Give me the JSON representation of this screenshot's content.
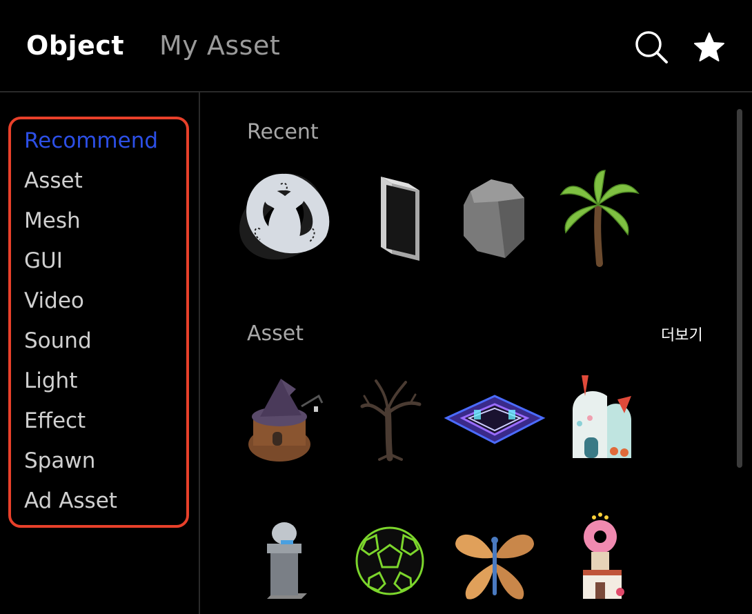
{
  "header": {
    "tabs": [
      {
        "label": "Object",
        "active": true
      },
      {
        "label": "My Asset",
        "active": false
      }
    ],
    "icons": [
      "search-icon",
      "star-icon"
    ]
  },
  "sidebar": {
    "highlight_color": "#e8402a",
    "active_color": "#2c4fe6",
    "items": [
      {
        "label": "Recommend",
        "active": true
      },
      {
        "label": "Asset"
      },
      {
        "label": "Mesh"
      },
      {
        "label": "GUI"
      },
      {
        "label": "Video"
      },
      {
        "label": "Sound"
      },
      {
        "label": "Light"
      },
      {
        "label": "Effect"
      },
      {
        "label": "Spawn"
      },
      {
        "label": "Ad Asset"
      }
    ]
  },
  "main": {
    "recent": {
      "title": "Recent",
      "items": [
        "trefoil-knot-thumbnail",
        "panel-thumbnail",
        "rock-thumbnail",
        "palm-tree-thumbnail"
      ]
    },
    "asset": {
      "title": "Asset",
      "more_label": "더보기",
      "items": [
        "witch-house-thumbnail",
        "dead-tree-thumbnail",
        "neon-arena-thumbnail",
        "candy-house-thumbnail",
        "pedestal-thumbnail",
        "neon-ball-thumbnail",
        "butterfly-thumbnail",
        "donut-tower-thumbnail"
      ]
    }
  }
}
